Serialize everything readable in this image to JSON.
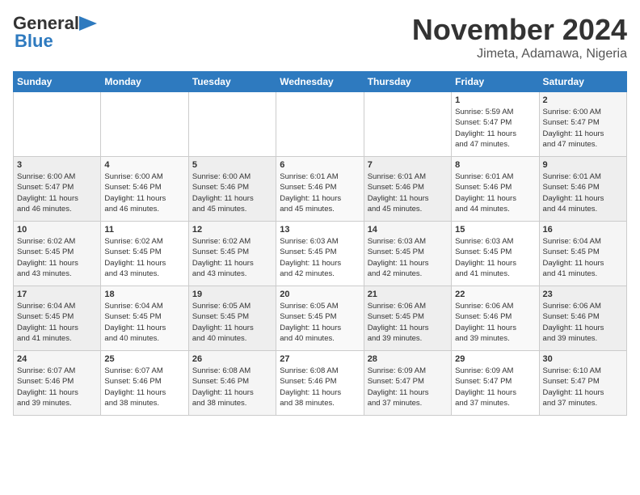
{
  "header": {
    "logo_line1": "General",
    "logo_line2": "Blue",
    "month": "November 2024",
    "location": "Jimeta, Adamawa, Nigeria"
  },
  "days_of_week": [
    "Sunday",
    "Monday",
    "Tuesday",
    "Wednesday",
    "Thursday",
    "Friday",
    "Saturday"
  ],
  "weeks": [
    [
      {
        "day": "",
        "info": ""
      },
      {
        "day": "",
        "info": ""
      },
      {
        "day": "",
        "info": ""
      },
      {
        "day": "",
        "info": ""
      },
      {
        "day": "",
        "info": ""
      },
      {
        "day": "1",
        "info": "Sunrise: 5:59 AM\nSunset: 5:47 PM\nDaylight: 11 hours\nand 47 minutes."
      },
      {
        "day": "2",
        "info": "Sunrise: 6:00 AM\nSunset: 5:47 PM\nDaylight: 11 hours\nand 47 minutes."
      }
    ],
    [
      {
        "day": "3",
        "info": "Sunrise: 6:00 AM\nSunset: 5:47 PM\nDaylight: 11 hours\nand 46 minutes."
      },
      {
        "day": "4",
        "info": "Sunrise: 6:00 AM\nSunset: 5:46 PM\nDaylight: 11 hours\nand 46 minutes."
      },
      {
        "day": "5",
        "info": "Sunrise: 6:00 AM\nSunset: 5:46 PM\nDaylight: 11 hours\nand 45 minutes."
      },
      {
        "day": "6",
        "info": "Sunrise: 6:01 AM\nSunset: 5:46 PM\nDaylight: 11 hours\nand 45 minutes."
      },
      {
        "day": "7",
        "info": "Sunrise: 6:01 AM\nSunset: 5:46 PM\nDaylight: 11 hours\nand 45 minutes."
      },
      {
        "day": "8",
        "info": "Sunrise: 6:01 AM\nSunset: 5:46 PM\nDaylight: 11 hours\nand 44 minutes."
      },
      {
        "day": "9",
        "info": "Sunrise: 6:01 AM\nSunset: 5:46 PM\nDaylight: 11 hours\nand 44 minutes."
      }
    ],
    [
      {
        "day": "10",
        "info": "Sunrise: 6:02 AM\nSunset: 5:45 PM\nDaylight: 11 hours\nand 43 minutes."
      },
      {
        "day": "11",
        "info": "Sunrise: 6:02 AM\nSunset: 5:45 PM\nDaylight: 11 hours\nand 43 minutes."
      },
      {
        "day": "12",
        "info": "Sunrise: 6:02 AM\nSunset: 5:45 PM\nDaylight: 11 hours\nand 43 minutes."
      },
      {
        "day": "13",
        "info": "Sunrise: 6:03 AM\nSunset: 5:45 PM\nDaylight: 11 hours\nand 42 minutes."
      },
      {
        "day": "14",
        "info": "Sunrise: 6:03 AM\nSunset: 5:45 PM\nDaylight: 11 hours\nand 42 minutes."
      },
      {
        "day": "15",
        "info": "Sunrise: 6:03 AM\nSunset: 5:45 PM\nDaylight: 11 hours\nand 41 minutes."
      },
      {
        "day": "16",
        "info": "Sunrise: 6:04 AM\nSunset: 5:45 PM\nDaylight: 11 hours\nand 41 minutes."
      }
    ],
    [
      {
        "day": "17",
        "info": "Sunrise: 6:04 AM\nSunset: 5:45 PM\nDaylight: 11 hours\nand 41 minutes."
      },
      {
        "day": "18",
        "info": "Sunrise: 6:04 AM\nSunset: 5:45 PM\nDaylight: 11 hours\nand 40 minutes."
      },
      {
        "day": "19",
        "info": "Sunrise: 6:05 AM\nSunset: 5:45 PM\nDaylight: 11 hours\nand 40 minutes."
      },
      {
        "day": "20",
        "info": "Sunrise: 6:05 AM\nSunset: 5:45 PM\nDaylight: 11 hours\nand 40 minutes."
      },
      {
        "day": "21",
        "info": "Sunrise: 6:06 AM\nSunset: 5:45 PM\nDaylight: 11 hours\nand 39 minutes."
      },
      {
        "day": "22",
        "info": "Sunrise: 6:06 AM\nSunset: 5:46 PM\nDaylight: 11 hours\nand 39 minutes."
      },
      {
        "day": "23",
        "info": "Sunrise: 6:06 AM\nSunset: 5:46 PM\nDaylight: 11 hours\nand 39 minutes."
      }
    ],
    [
      {
        "day": "24",
        "info": "Sunrise: 6:07 AM\nSunset: 5:46 PM\nDaylight: 11 hours\nand 39 minutes."
      },
      {
        "day": "25",
        "info": "Sunrise: 6:07 AM\nSunset: 5:46 PM\nDaylight: 11 hours\nand 38 minutes."
      },
      {
        "day": "26",
        "info": "Sunrise: 6:08 AM\nSunset: 5:46 PM\nDaylight: 11 hours\nand 38 minutes."
      },
      {
        "day": "27",
        "info": "Sunrise: 6:08 AM\nSunset: 5:46 PM\nDaylight: 11 hours\nand 38 minutes."
      },
      {
        "day": "28",
        "info": "Sunrise: 6:09 AM\nSunset: 5:47 PM\nDaylight: 11 hours\nand 37 minutes."
      },
      {
        "day": "29",
        "info": "Sunrise: 6:09 AM\nSunset: 5:47 PM\nDaylight: 11 hours\nand 37 minutes."
      },
      {
        "day": "30",
        "info": "Sunrise: 6:10 AM\nSunset: 5:47 PM\nDaylight: 11 hours\nand 37 minutes."
      }
    ]
  ]
}
